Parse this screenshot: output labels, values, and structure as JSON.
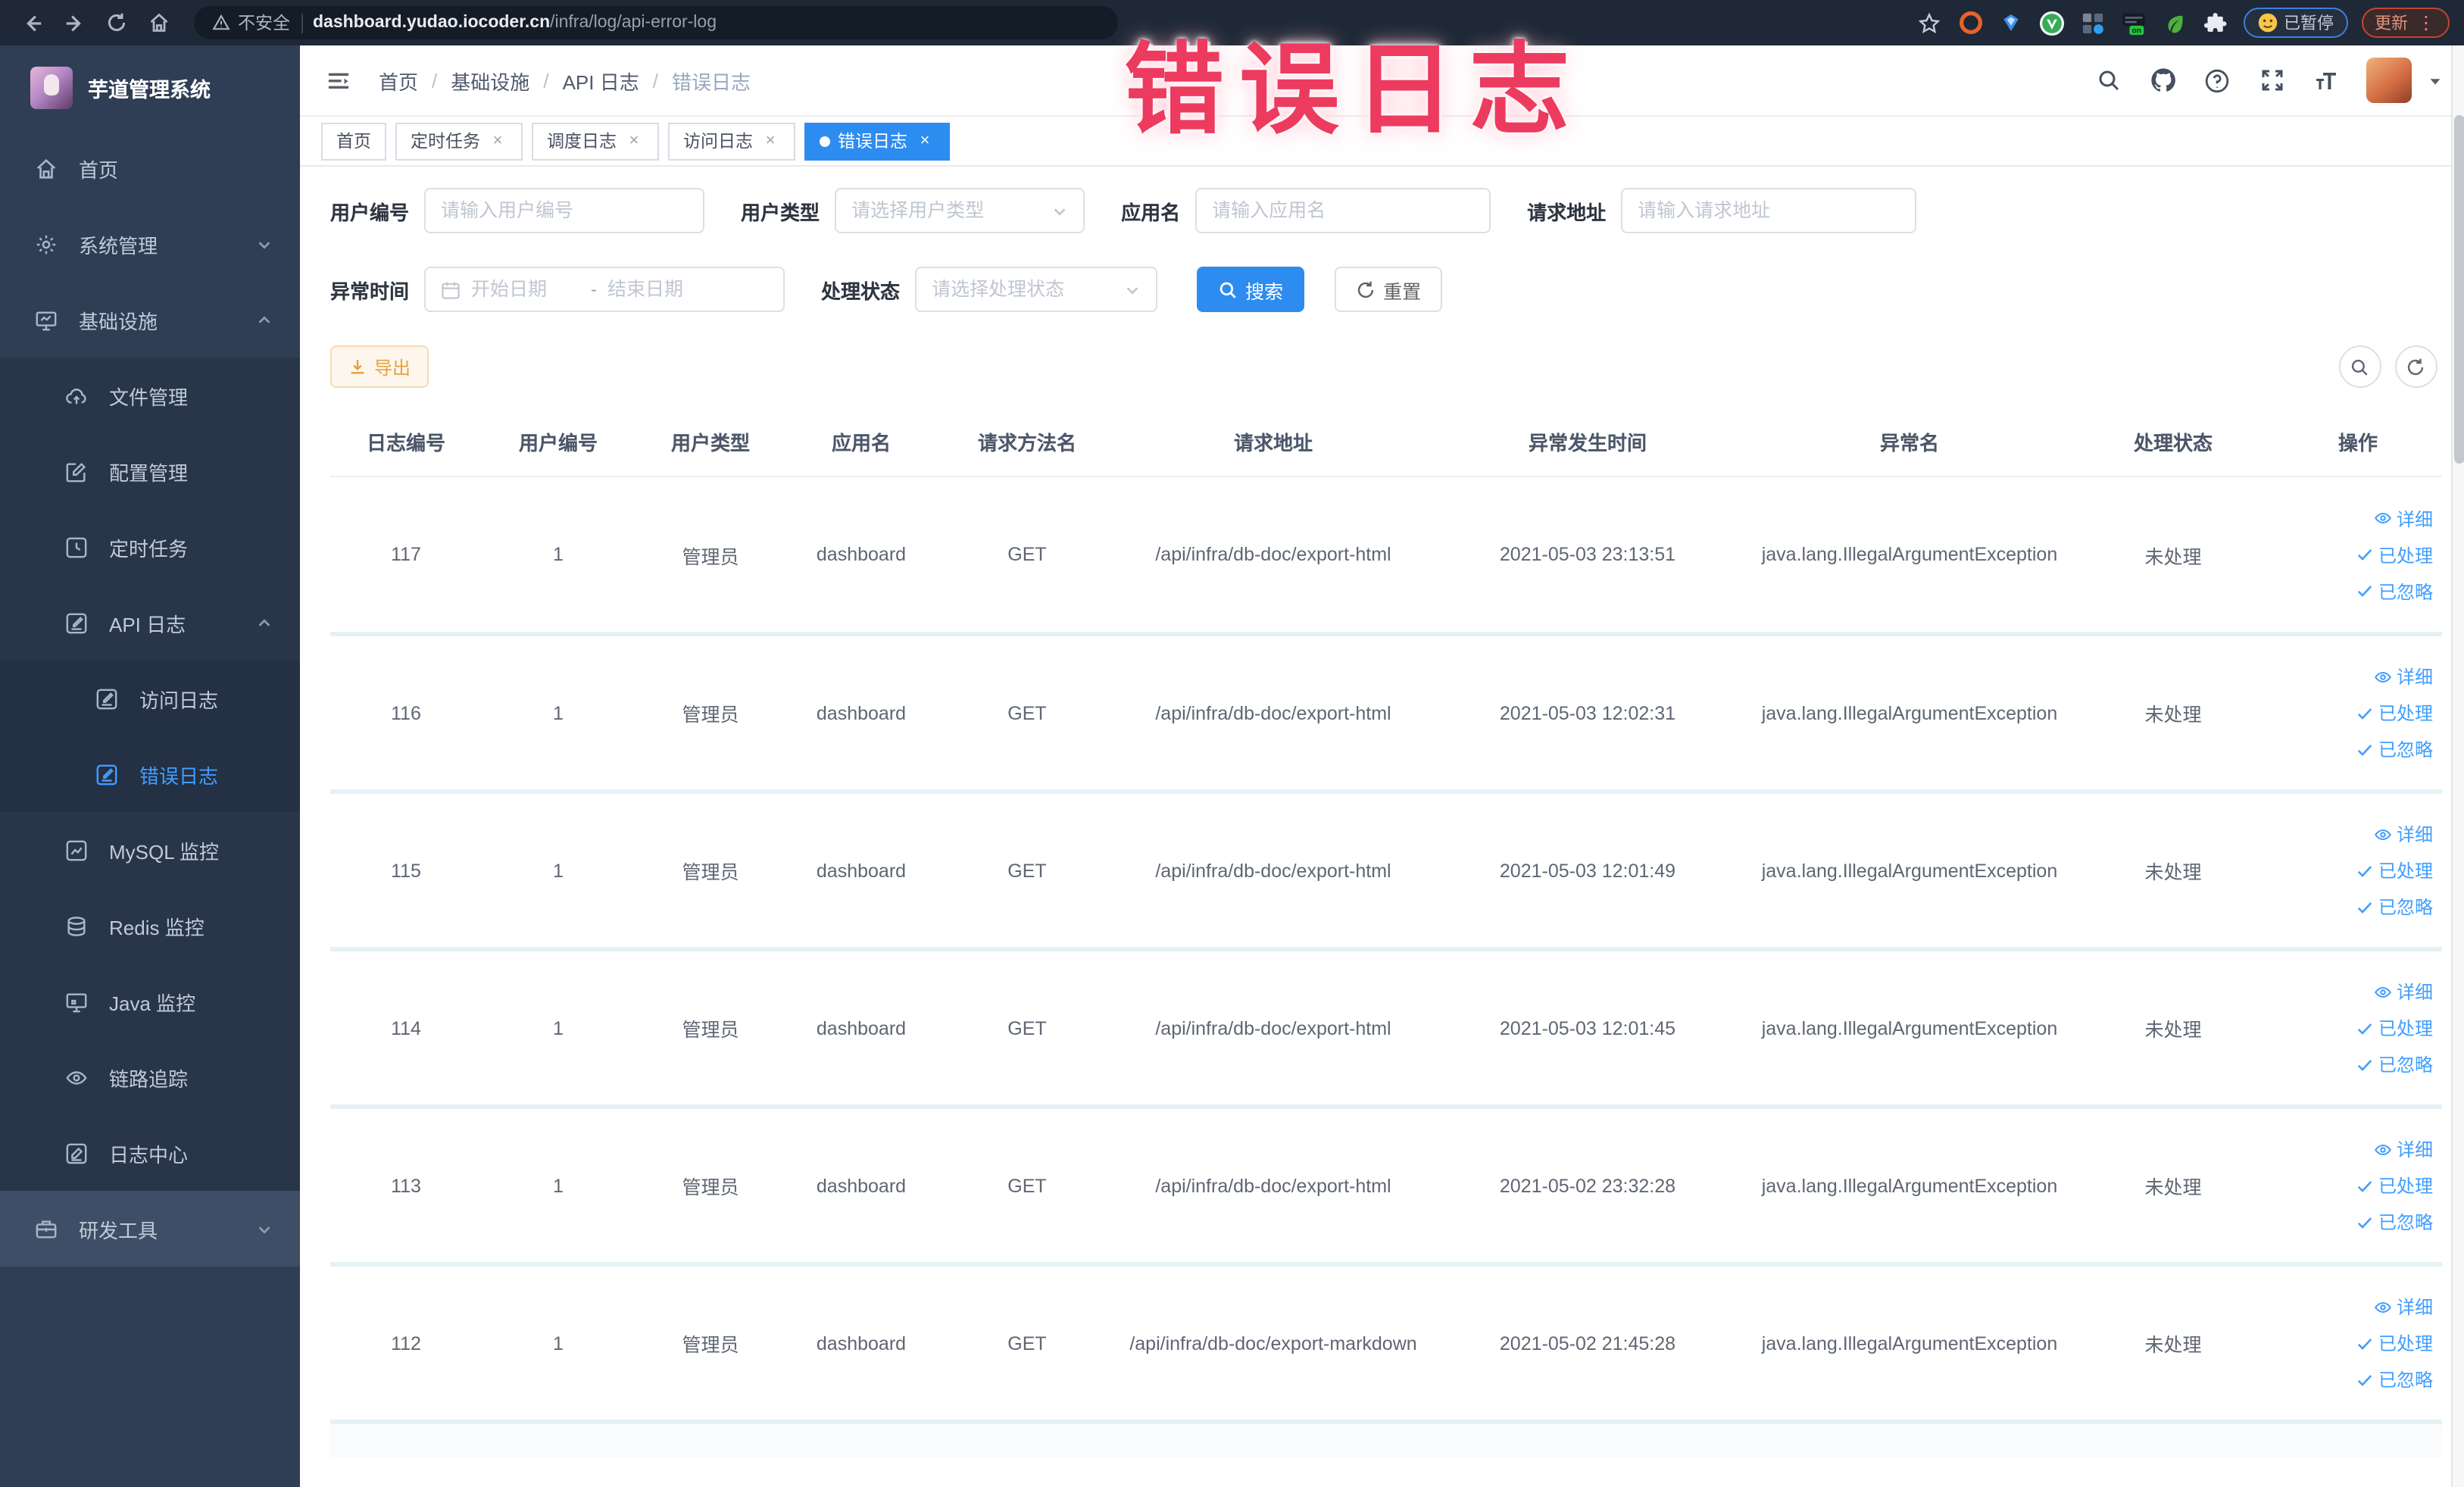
{
  "colors": {
    "accent": "#2d8cf0",
    "link": "#409eff",
    "warning": "#e6a23c",
    "annotation": "#ed3a5f",
    "sidebar_bg": "#2f3e55"
  },
  "browser": {
    "security_label": "不安全",
    "url_host": "dashboard.yudao.iocoder.cn",
    "url_path": "/infra/log/api-error-log",
    "paused_badge": "已暂停",
    "update_badge": "更新",
    "kebab": "⋮",
    "on_badge": "on"
  },
  "overlay": {
    "annotation": "错误日志"
  },
  "sidebar": {
    "title": "芋道管理系统",
    "items": [
      {
        "label": "首页"
      },
      {
        "label": "系统管理"
      },
      {
        "label": "基础设施"
      },
      {
        "label": "文件管理"
      },
      {
        "label": "配置管理"
      },
      {
        "label": "定时任务"
      },
      {
        "label": "API 日志"
      },
      {
        "label": "访问日志"
      },
      {
        "label": "错误日志"
      },
      {
        "label": "MySQL 监控"
      },
      {
        "label": "Redis 监控"
      },
      {
        "label": "Java 监控"
      },
      {
        "label": "链路追踪"
      },
      {
        "label": "日志中心"
      },
      {
        "label": "研发工具"
      }
    ]
  },
  "breadcrumb": {
    "sep": "/",
    "items": [
      "首页",
      "基础设施",
      "API 日志",
      "错误日志"
    ]
  },
  "tabs": [
    {
      "label": "首页"
    },
    {
      "label": "定时任务"
    },
    {
      "label": "调度日志"
    },
    {
      "label": "访问日志"
    },
    {
      "label": "错误日志"
    }
  ],
  "tab_close": "×",
  "filters": {
    "user_id": {
      "label": "用户编号",
      "placeholder": "请输入用户编号"
    },
    "user_type": {
      "label": "用户类型",
      "placeholder": "请选择用户类型"
    },
    "app_name": {
      "label": "应用名",
      "placeholder": "请输入应用名"
    },
    "request_url": {
      "label": "请求地址",
      "placeholder": "请输入请求地址"
    },
    "exception_time": {
      "label": "异常时间",
      "start_placeholder": "开始日期",
      "separator": "-",
      "end_placeholder": "结束日期"
    },
    "process_status": {
      "label": "处理状态",
      "placeholder": "请选择处理状态"
    },
    "search_button": "搜索",
    "reset_button": "重置"
  },
  "toolbar": {
    "export_button": "导出"
  },
  "table": {
    "columns": [
      "日志编号",
      "用户编号",
      "用户类型",
      "应用名",
      "请求方法名",
      "请求地址",
      "异常发生时间",
      "异常名",
      "处理状态",
      "操作"
    ],
    "actions": [
      "详细",
      "已处理",
      "已忽略"
    ],
    "rows": [
      {
        "id": "117",
        "user_id": "1",
        "user_type": "管理员",
        "app": "dashboard",
        "method": "GET",
        "url": "/api/infra/db-doc/export-html",
        "time": "2021-05-03 23:13:51",
        "exception": "java.lang.IllegalArgumentException",
        "status": "未处理"
      },
      {
        "id": "116",
        "user_id": "1",
        "user_type": "管理员",
        "app": "dashboard",
        "method": "GET",
        "url": "/api/infra/db-doc/export-html",
        "time": "2021-05-03 12:02:31",
        "exception": "java.lang.IllegalArgumentException",
        "status": "未处理"
      },
      {
        "id": "115",
        "user_id": "1",
        "user_type": "管理员",
        "app": "dashboard",
        "method": "GET",
        "url": "/api/infra/db-doc/export-html",
        "time": "2021-05-03 12:01:49",
        "exception": "java.lang.IllegalArgumentException",
        "status": "未处理"
      },
      {
        "id": "114",
        "user_id": "1",
        "user_type": "管理员",
        "app": "dashboard",
        "method": "GET",
        "url": "/api/infra/db-doc/export-html",
        "time": "2021-05-03 12:01:45",
        "exception": "java.lang.IllegalArgumentException",
        "status": "未处理"
      },
      {
        "id": "113",
        "user_id": "1",
        "user_type": "管理员",
        "app": "dashboard",
        "method": "GET",
        "url": "/api/infra/db-doc/export-html",
        "time": "2021-05-02 23:32:28",
        "exception": "java.lang.IllegalArgumentException",
        "status": "未处理"
      },
      {
        "id": "112",
        "user_id": "1",
        "user_type": "管理员",
        "app": "dashboard",
        "method": "GET",
        "url": "/api/infra/db-doc/export-markdown",
        "time": "2021-05-02 21:45:28",
        "exception": "java.lang.IllegalArgumentException",
        "status": "未处理"
      }
    ]
  }
}
